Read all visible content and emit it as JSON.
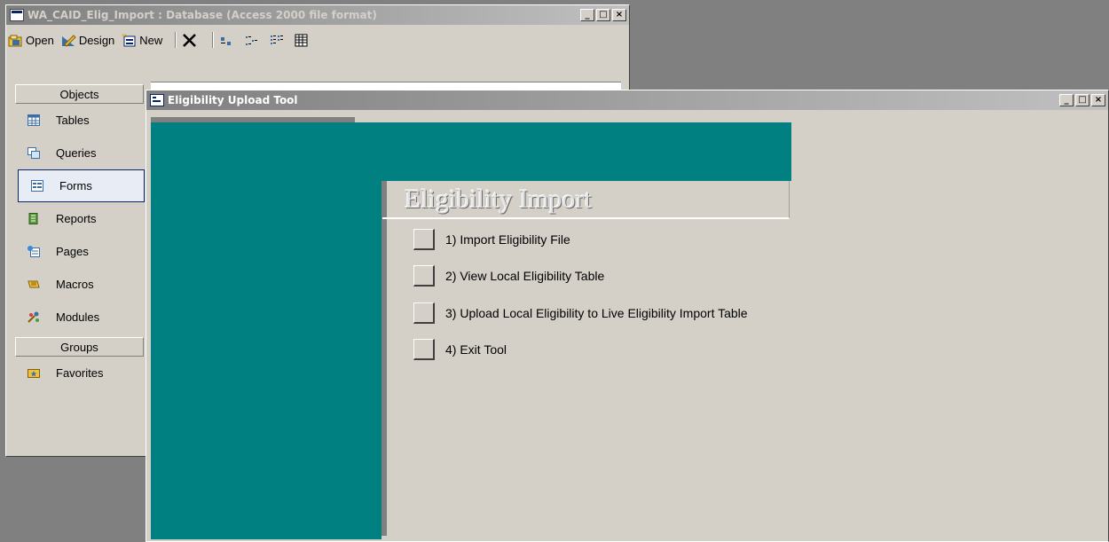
{
  "db_window": {
    "title": "WA_CAID_Elig_Import : Database (Access 2000 file format)",
    "controls": {
      "minimize": "_",
      "maximize": "□",
      "close": "×"
    }
  },
  "toolbar": {
    "open_label": "Open",
    "design_label": "Design",
    "new_label": "New"
  },
  "objects": {
    "header": "Objects",
    "items": [
      {
        "label": "Tables",
        "icon": "table-icon"
      },
      {
        "label": "Queries",
        "icon": "query-icon"
      },
      {
        "label": "Forms",
        "icon": "form-icon"
      },
      {
        "label": "Reports",
        "icon": "report-icon"
      },
      {
        "label": "Pages",
        "icon": "page-icon"
      },
      {
        "label": "Macros",
        "icon": "macro-icon"
      },
      {
        "label": "Modules",
        "icon": "module-icon"
      }
    ],
    "groups_header": "Groups",
    "favorites_label": "Favorites"
  },
  "form_window": {
    "title": "Eligibility Upload Tool",
    "heading": "Eligibility Import",
    "menu": [
      "1)  Import Eligibility File",
      "2)  View Local Eligibility Table",
      "3)  Upload Local Eligibility to Live Eligibility Import Table",
      "4)  Exit Tool"
    ]
  },
  "colors": {
    "teal": "#008080",
    "window_face": "#d4d0c8",
    "inactive_title": "#808080"
  }
}
